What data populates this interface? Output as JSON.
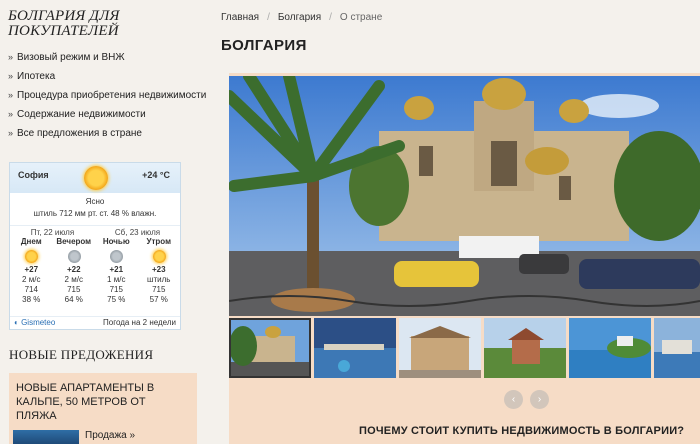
{
  "sidebar": {
    "title_line1": "БОЛГАРИЯ ДЛЯ",
    "title_line2": "ПОКУПАТЕЛЕЙ",
    "links": [
      "Визовый режим и ВНЖ",
      "Ипотека",
      "Процедура приобретения недвижимости",
      "Содержание недвижимости",
      "Все предложения в стране"
    ]
  },
  "weather": {
    "city": "София",
    "temp": "+24 °C",
    "condition": "Ясно",
    "details": "штиль  712 мм рт. ст.  48 % влажн.",
    "date1": "Пт, 22 июля",
    "date2": "Сб, 23 июля",
    "cols": [
      {
        "part": "Днем",
        "icon": "sun-icon",
        "temp": "+27",
        "wind": "2 м/с",
        "pressure": "714",
        "humidity": "38 %"
      },
      {
        "part": "Вечером",
        "icon": "moon-icon",
        "temp": "+22",
        "wind": "2 м/с",
        "pressure": "715",
        "humidity": "64 %"
      },
      {
        "part": "Ночью",
        "icon": "moon-icon",
        "temp": "+21",
        "wind": "1 м/с",
        "pressure": "715",
        "humidity": "75 %"
      },
      {
        "part": "Утром",
        "icon": "sun-icon",
        "temp": "+23",
        "wind": "штиль",
        "pressure": "715",
        "humidity": "57 %"
      }
    ],
    "brand": "Gismeteo",
    "forecast_link": "Погода на 2 недели"
  },
  "new_offers": {
    "title": "НОВЫЕ ПРЕДОЖЕНИЯ",
    "promo_line1": "НОВЫЕ АПАРТАМЕНТЫ В",
    "promo_line2": "КАЛЬПЕ, 50 МЕТРОВ ОТ",
    "promo_line3": "ПЛЯЖА",
    "promo_link": "Продажа »"
  },
  "breadcrumb": {
    "items": [
      "Главная",
      "Болгария",
      "О стране"
    ],
    "sep": "/"
  },
  "page_title": "БОЛГАРИЯ",
  "slider": {
    "prev": "‹",
    "next": "›"
  },
  "why_heading": "ПОЧЕМУ СТОИТ КУПИТЬ НЕДВИЖИМОСТЬ В БОЛГАРИИ?",
  "colors": {
    "accent_bg": "#f6dcc6",
    "page_bg": "#f4f1ec",
    "weather_border": "#c9dbe9",
    "link_blue": "#2a6fb4"
  }
}
